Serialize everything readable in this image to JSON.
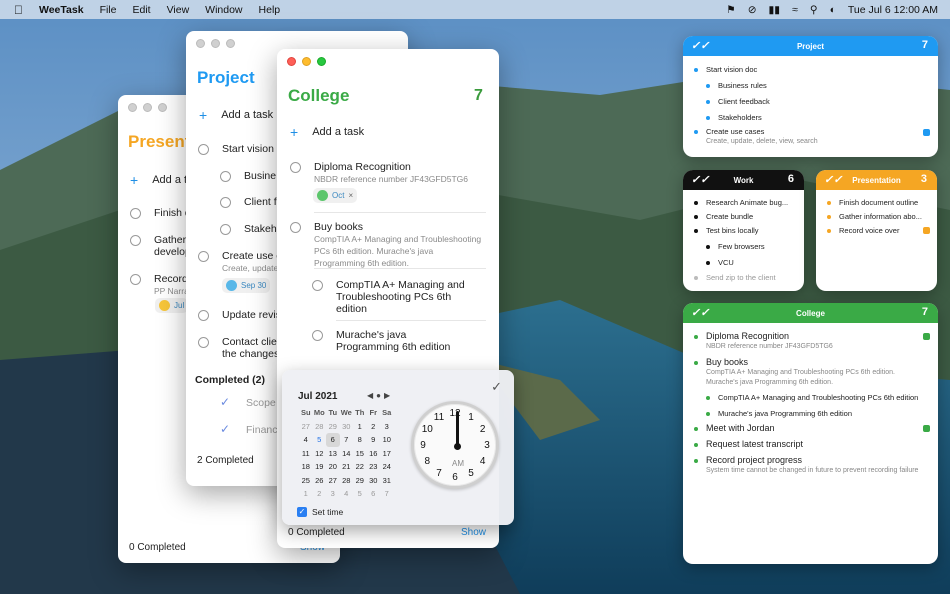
{
  "menubar": {
    "app_name": "WeeTask",
    "menus": [
      "File",
      "Edit",
      "View",
      "Window",
      "Help"
    ],
    "datetime": "Tue Jul 6  12:00 AM"
  },
  "presentation_window": {
    "title": "Present",
    "add_label": "Add a t",
    "tasks": [
      "Finish d",
      "Gather",
      "develop",
      "Record",
      "PP Narra",
      "Jul"
    ],
    "footer": "0 Completed",
    "show": "Show"
  },
  "project_window": {
    "title": "Project",
    "add_label": "Add a task",
    "tasks": [
      "Start vision d",
      "Busine",
      "Client f",
      "Stakeh",
      "Create use c",
      "Create, update",
      "Update revis",
      "Contact clie",
      "the changes"
    ],
    "chip": "Sep 30",
    "completed_header": "Completed (2)",
    "completed": [
      "Scope",
      "Financ"
    ],
    "footer": "2 Completed"
  },
  "college_window": {
    "title": "College",
    "count": "7",
    "add_label": "Add a task",
    "tasks": [
      {
        "title": "Diploma Recognition",
        "sub": "NBDR reference number JF43GFD5TG6"
      },
      {
        "title": "Buy books",
        "sub": "CompTIA A+ Managing and Troubleshooting PCs 6th edition. Murache's java Programming 6th edition."
      },
      {
        "title": "CompTIA A+ Managing and Troubleshooting PCs 6th edition",
        "sub": ""
      },
      {
        "title": "Murache's java Programming 6th edition",
        "sub": ""
      }
    ],
    "chip": "Oct",
    "footer": "0 Completed",
    "show": "Show"
  },
  "date_picker": {
    "month": "Jul 2021",
    "weekdays": [
      "Su",
      "Mo",
      "Tu",
      "We",
      "Th",
      "Fr",
      "Sa"
    ],
    "days": [
      "27",
      "28",
      "29",
      "30",
      "1",
      "2",
      "3",
      "4",
      "5",
      "6",
      "7",
      "8",
      "9",
      "10",
      "11",
      "12",
      "13",
      "14",
      "15",
      "16",
      "17",
      "18",
      "19",
      "20",
      "21",
      "22",
      "23",
      "24",
      "25",
      "26",
      "27",
      "28",
      "29",
      "30",
      "31",
      "1",
      "2",
      "3",
      "4",
      "5",
      "6",
      "7"
    ],
    "clock_numbers": [
      "12",
      "1",
      "2",
      "3",
      "4",
      "5",
      "6",
      "7",
      "8",
      "9",
      "10",
      "11"
    ],
    "ampm": "AM",
    "set_time_label": "Set time"
  },
  "widgets": {
    "project": {
      "title": "Project",
      "count": "7",
      "rows": [
        "Start vision doc",
        "Business rules",
        "Client feedback",
        "Stakeholders",
        "Create use cases",
        "Create, update, delete, view, search"
      ]
    },
    "work": {
      "title": "Work",
      "count": "6",
      "rows": [
        "Research Animate bug...",
        "Create bundle",
        "Test bins locally",
        "Few browsers",
        "VCU",
        "Send zip to the client"
      ]
    },
    "presentation": {
      "title": "Presentation",
      "count": "3",
      "rows": [
        "Finish document outline",
        "Gather information abo...",
        "Record voice over"
      ]
    },
    "college": {
      "title": "College",
      "count": "7",
      "rows": [
        "Diploma Recognition",
        "NBDR reference number JF43GFD5TG6",
        "Buy books",
        "CompTIA A+ Managing and Troubleshooting PCs 6th edition.",
        "Murache's java Programming 6th edition.",
        "CompTIA A+ Managing and Troubleshooting PCs 6th edition",
        "Murache's java Programming 6th edition",
        "Meet with Jordan",
        "Request latest transcript",
        "Record project progress",
        "System time cannot be changed in future to prevent recording failure"
      ]
    }
  },
  "colors": {
    "project": "#1f9af2",
    "work": "#111111",
    "presentation": "#f5a623",
    "college": "#3aaa46"
  }
}
